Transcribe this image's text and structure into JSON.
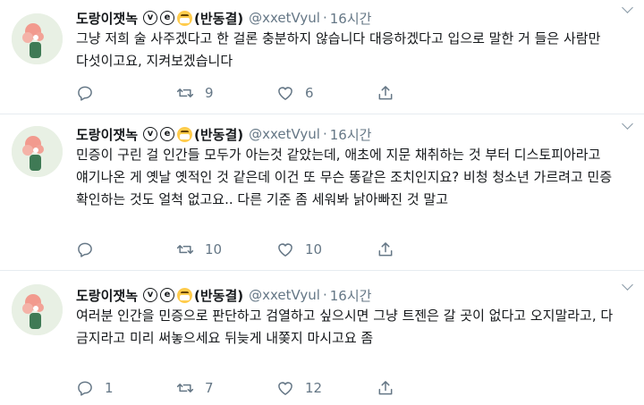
{
  "tweets": [
    {
      "name": "도랑이잿녹",
      "badge_v": "v",
      "badge_e": "e",
      "name_suffix": "(반동결)",
      "handle": "@xxetVyul",
      "dot": "·",
      "time": "16시간",
      "text": "그냥 저희 술 사주겠다고 한 걸론 충분하지 않습니다 대응하겠다고 입으로 말한 거 들은 사람만 다섯이고요, 지켜보겠습니다",
      "replies": "",
      "retweets": "9",
      "likes": "6"
    },
    {
      "name": "도랑이잿녹",
      "badge_v": "v",
      "badge_e": "e",
      "name_suffix": "(반동결)",
      "handle": "@xxetVyul",
      "dot": "·",
      "time": "16시간",
      "text": "민증이 구린 걸 인간들 모두가 아는것 같았는데, 애초에 지문 채취하는 것 부터 디스토피아라고 얘기나온 게 옛날 옛적인 것 같은데 이건 또 무슨 똥같은 조치인지요? 비청 청소년 가르려고 민증 확인하는 것도 얼척 없고요.. 다른 기준 좀 세워봐 낡아빠진 것 말고",
      "replies": "",
      "retweets": "10",
      "likes": "10"
    },
    {
      "name": "도랑이잿녹",
      "badge_v": "v",
      "badge_e": "e",
      "name_suffix": "(반동결)",
      "handle": "@xxetVyul",
      "dot": "·",
      "time": "16시간",
      "text": "여러분 인간을 민증으로 판단하고 검열하고 싶으시면 그냥 트젠은 갈 곳이 없다고 오지말라고, 다 금지라고 미리 써놓으세요 뒤늦게 내쫒지 마시고요 좀",
      "replies": "1",
      "retweets": "7",
      "likes": "12"
    }
  ],
  "icons": {
    "reply": "reply-icon",
    "retweet": "retweet-icon",
    "like": "like-icon",
    "share": "share-icon",
    "more": "chevron-down-icon"
  },
  "colors": {
    "text": "#14171a",
    "muted": "#657786",
    "divider": "#e6ecf0",
    "avatar_bg": "#e8f0e4",
    "emoji": "#ffcc4d"
  }
}
